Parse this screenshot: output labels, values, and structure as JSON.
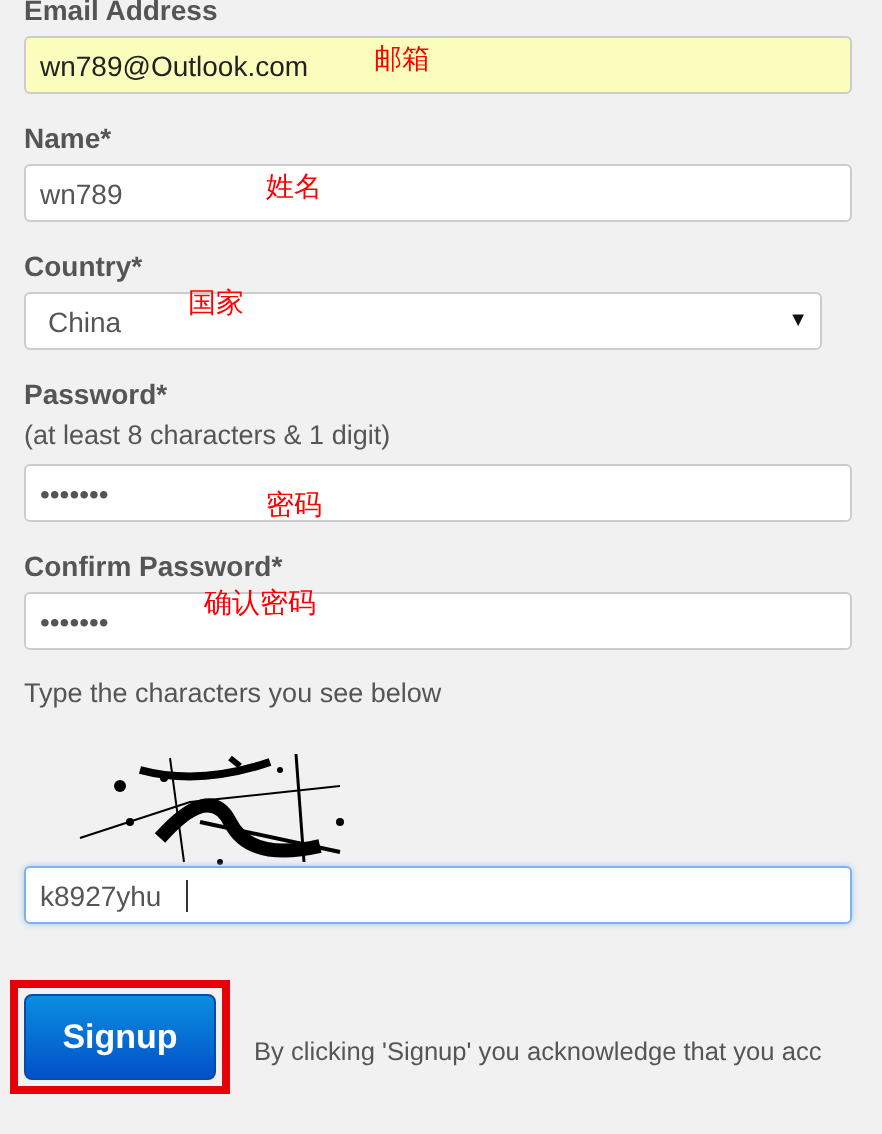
{
  "fields": [
    {
      "kind": "text",
      "label": "Email Address",
      "value": "wn789@Outlook.com",
      "autofilled": true,
      "focused": false,
      "annotation": "邮箱"
    },
    {
      "kind": "text",
      "label": "Name*",
      "value": "wn789",
      "autofilled": false,
      "focused": false,
      "annotation": "姓名"
    },
    {
      "kind": "select",
      "label": "Country*",
      "value": "China",
      "caret": "▼",
      "autofilled": false,
      "focused": false,
      "annotation": "国家"
    },
    {
      "kind": "password",
      "label": "Password*",
      "hint": "(at least 8 characters & 1 digit)",
      "value": "•••••••",
      "autofilled": false,
      "focused": false,
      "annotation": "密码"
    },
    {
      "kind": "password",
      "label": "Confirm Password*",
      "value": "•••••••",
      "autofilled": false,
      "focused": false,
      "annotation": "确认密码"
    },
    {
      "kind": "captcha",
      "label": "Type the characters you see below",
      "value": "k8927yhu",
      "autofilled": false,
      "focused": true
    }
  ],
  "signup": {
    "label": "Signup",
    "highlighted": true,
    "note": "By clicking 'Signup' you acknowledge that you acc"
  }
}
